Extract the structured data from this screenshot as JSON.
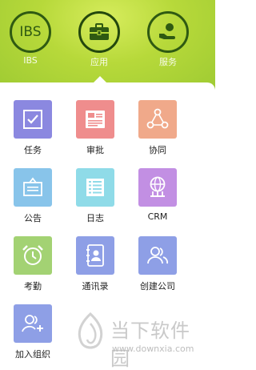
{
  "header": {
    "items": [
      {
        "label": "IBS",
        "icon_text": "IBS",
        "icon": "ibs-icon"
      },
      {
        "label": "应用",
        "icon": "briefcase-icon",
        "active": true
      },
      {
        "label": "服务",
        "icon": "service-person-icon"
      }
    ]
  },
  "apps": [
    {
      "label": "任务",
      "icon": "task-checkbox-icon",
      "color": "#8b88e0"
    },
    {
      "label": "审批",
      "icon": "approval-document-icon",
      "color": "#ef8d8d"
    },
    {
      "label": "协同",
      "icon": "collaboration-share-icon",
      "color": "#f0a98a"
    },
    {
      "label": "公告",
      "icon": "announcement-icon",
      "color": "#88c4ea"
    },
    {
      "label": "日志",
      "icon": "log-list-icon",
      "color": "#8fdbe8"
    },
    {
      "label": "CRM",
      "icon": "crm-globe-icon",
      "color": "#c28fe3"
    },
    {
      "label": "考勤",
      "icon": "attendance-clock-icon",
      "color": "#a3d273"
    },
    {
      "label": "通讯录",
      "icon": "contacts-book-icon",
      "color": "#8e9fe6"
    },
    {
      "label": "创建公司",
      "icon": "create-company-people-icon",
      "color": "#8e9fe6"
    },
    {
      "label": "加入组织",
      "icon": "join-organization-icon",
      "color": "#8e9fe6"
    }
  ],
  "watermark": {
    "text": "当下软件园",
    "url": "www.downxia.com"
  }
}
